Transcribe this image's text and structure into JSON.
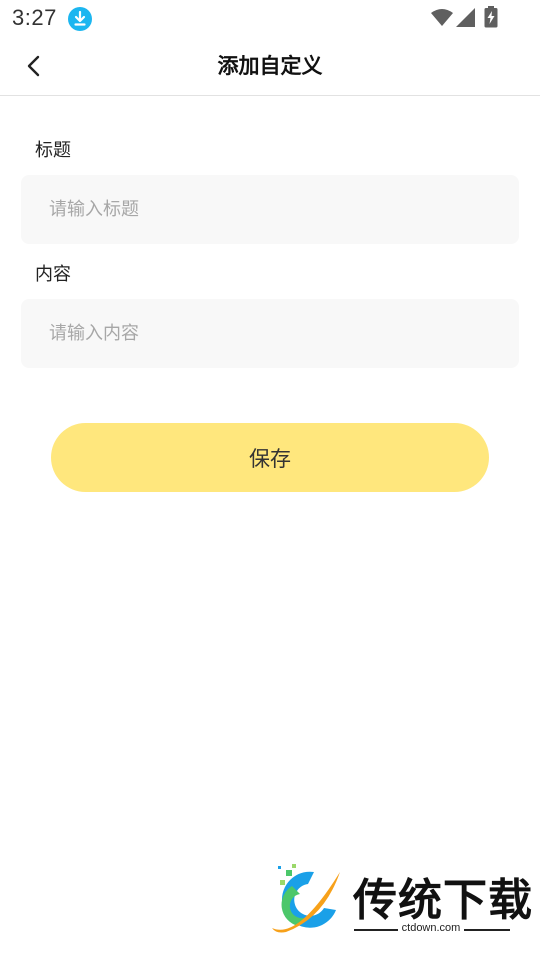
{
  "status_bar": {
    "time": "3:27",
    "icons": [
      "download-icon",
      "wifi-icon",
      "signal-icon",
      "battery-charging-icon"
    ],
    "badge_color": "#1cb6f0"
  },
  "nav": {
    "back_icon": "chevron-left-icon",
    "title": "添加自定义"
  },
  "form": {
    "title_label": "标题",
    "title_placeholder": "请输入标题",
    "title_value": "",
    "content_label": "内容",
    "content_placeholder": "请输入内容",
    "content_value": "",
    "save_label": "保存"
  },
  "watermark": {
    "brand": "传统下载",
    "url": "ctdown.com"
  },
  "colors": {
    "accent": "#ffe77d",
    "input_bg": "#f8f8f8",
    "placeholder": "#a7a7a7"
  }
}
